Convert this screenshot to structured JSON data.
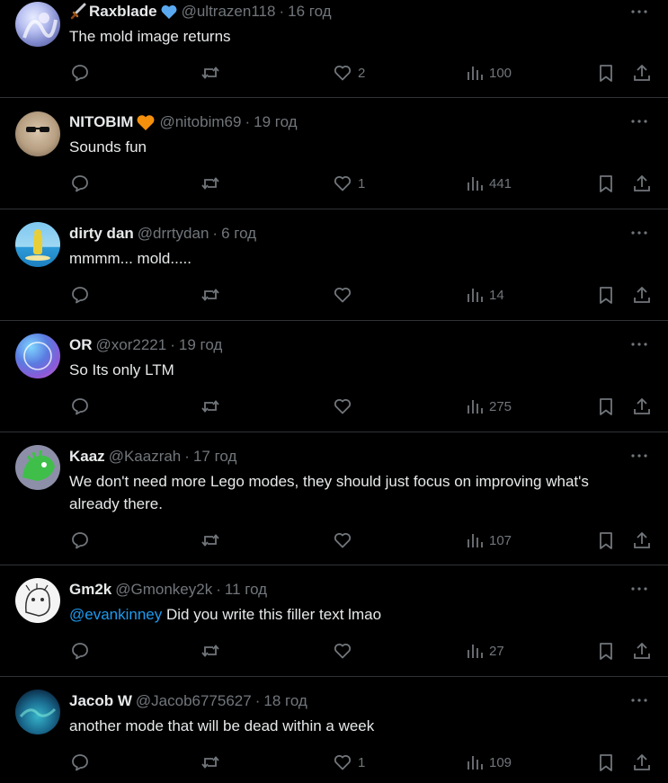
{
  "tweets": [
    {
      "name": "Raxblade",
      "handle": "@ultrazen118",
      "sep": "·",
      "time": "16 год",
      "text": "The mold image returns",
      "likes": "2",
      "views": "100",
      "name_prefix_icon": "sword-icon",
      "badge": "blue-heart-icon"
    },
    {
      "name": "NITOBIM",
      "handle": "@nitobim69",
      "sep": "·",
      "time": "19 год",
      "text": "Sounds fun",
      "likes": "1",
      "views": "441",
      "badge": "orange-heart-icon"
    },
    {
      "name": "dirty dan",
      "handle": "@drrtydan",
      "sep": "·",
      "time": "6 год",
      "text": "mmmm... mold.....",
      "likes": "",
      "views": "14"
    },
    {
      "name": "OR",
      "handle": "@xor2221",
      "sep": "·",
      "time": "19 год",
      "text": "So Its only LTM",
      "likes": "",
      "views": "275"
    },
    {
      "name": "Kaaz",
      "handle": "@Kaazrah",
      "sep": "·",
      "time": "17 год",
      "text": "We don't need more Lego modes, they should just focus on improving what's already there.",
      "likes": "",
      "views": "107"
    },
    {
      "name": "Gm2k",
      "handle": "@Gmonkey2k",
      "sep": "·",
      "time": "11 год",
      "mention": "@evankinney",
      "text": "Did you write this filler text lmao",
      "likes": "",
      "views": "27"
    },
    {
      "name": "Jacob W",
      "handle": "@Jacob6775627",
      "sep": "·",
      "time": "18 год",
      "text": "another mode that will be dead within a week",
      "likes": "1",
      "views": "109"
    }
  ],
  "colors": {
    "background": "#000000",
    "text": "#e7e9ea",
    "muted": "#71767b",
    "link": "#1d9bf0",
    "divider": "#2f3336"
  }
}
